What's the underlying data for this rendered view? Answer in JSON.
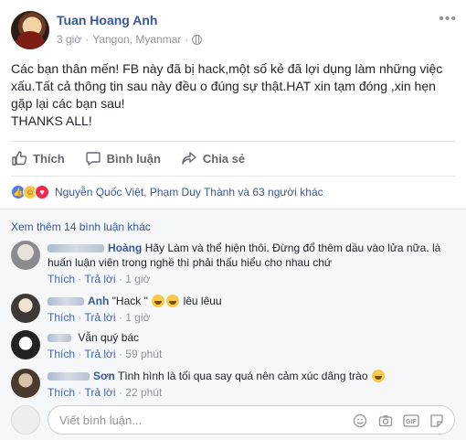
{
  "post": {
    "author": "Tuan Hoang Anh",
    "time": "3 giờ",
    "separator": "·",
    "location": "Yangon, Myanmar",
    "separator2": "·",
    "more_icon": "•••",
    "text_lines": [
      "Các bạn thân mến! FB này đã bị hack,một số kẻ đã lợi dụng làm những việc xấu.Tất cả thông tin sau này đều o đúng sự thật.HAT xin tạm đóng ,xin hẹn gặp lại các bạn sau!",
      "THANKS ALL!"
    ]
  },
  "actions": {
    "like_label": "Thích",
    "comment_label": "Bình luận",
    "share_label": "Chia sẻ"
  },
  "reactions": {
    "names": "Nguyễn Quốc Việt, Phạm Duy Thành và 63 người khác"
  },
  "comments": {
    "more_label": "Xem thêm 14 bình luận khác",
    "items": [
      {
        "name": "Hoàng",
        "text": "Hãy Làm và thể hiện thôi. Đừng đổ thêm dầu vào lửa nữa. là huấn luận viên trong nghề thì phải thấu hiểu cho nhau chứ",
        "like": "Thích",
        "reply": "Trả lời",
        "time": "1 giờ",
        "sep": "·"
      },
      {
        "name": "Anh",
        "text_before": "\"Hack \"",
        "text_after": "lêu lêuu",
        "like": "Thích",
        "reply": "Trả lời",
        "time": "1 giờ",
        "sep": "·"
      },
      {
        "name": "",
        "text": "Vẫn quý bác",
        "like": "Thích",
        "reply": "Trả lời",
        "time": "59 phút",
        "sep": "·"
      },
      {
        "name": "Sơn",
        "text": "Tình hình là tối qua say quá nên cảm xúc dâng trào",
        "like": "Thích",
        "reply": "Trả lời",
        "time": "22 phút",
        "sep": "·"
      }
    ],
    "write_placeholder": "Viết bình luận...",
    "gif_label": "GIF"
  },
  "colors": {
    "link": "#365899",
    "muted": "#90949c",
    "like_blue": "#4a7cf6"
  }
}
